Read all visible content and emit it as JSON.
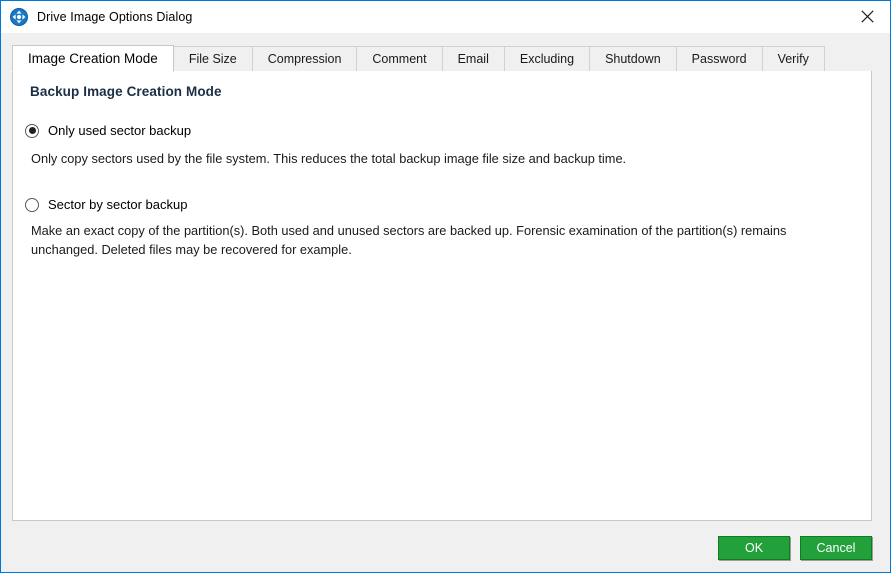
{
  "window": {
    "title": "Drive Image Options Dialog",
    "icon": "sync-arrows-icon",
    "close_label": "×",
    "border_color": "#0078d7"
  },
  "tabs": [
    {
      "label": "Image Creation Mode",
      "active": true
    },
    {
      "label": "File Size",
      "active": false
    },
    {
      "label": "Compression",
      "active": false
    },
    {
      "label": "Comment",
      "active": false
    },
    {
      "label": "Email",
      "active": false
    },
    {
      "label": "Excluding",
      "active": false
    },
    {
      "label": "Shutdown",
      "active": false
    },
    {
      "label": "Password",
      "active": false
    },
    {
      "label": "Verify",
      "active": false
    }
  ],
  "page": {
    "heading": "Backup Image Creation Mode",
    "options": [
      {
        "label": "Only used sector backup",
        "selected": true,
        "description": "Only copy sectors used by the file system. This reduces the total backup image file size and backup time."
      },
      {
        "label": "Sector by sector backup",
        "selected": false,
        "description": "Make an exact copy of the partition(s). Both used and unused sectors are backed up. Forensic examination of the partition(s) remains unchanged. Deleted files may be recovered for example."
      }
    ]
  },
  "footer": {
    "ok_label": "OK",
    "cancel_label": "Cancel",
    "button_color": "#22a03a"
  }
}
